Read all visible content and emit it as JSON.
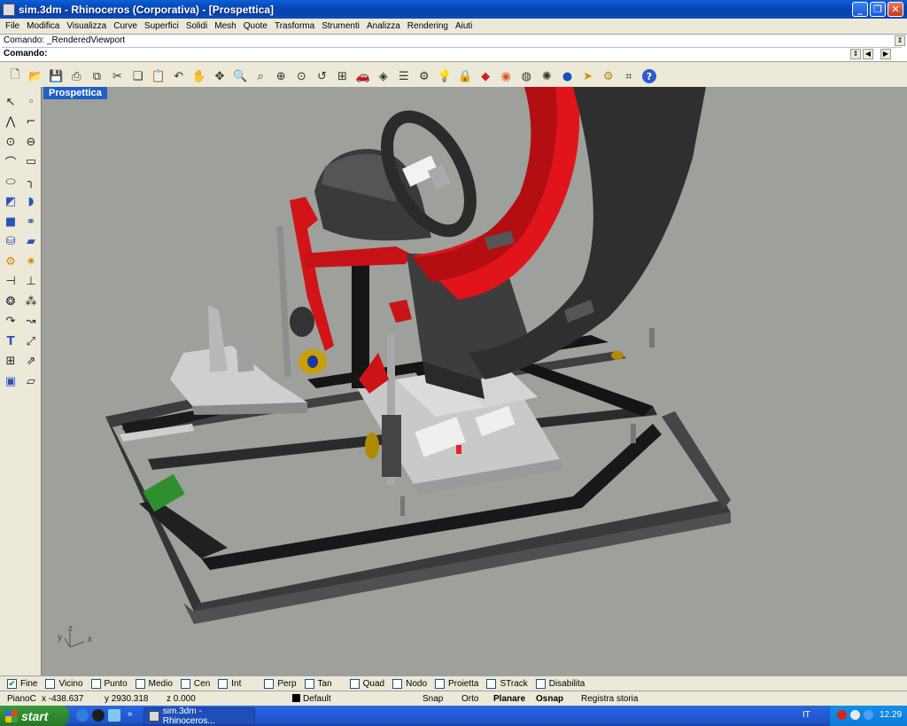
{
  "window": {
    "title": "sim.3dm - Rhinoceros (Corporativa) - [Prospettica]",
    "minimize_icon": "minimize-icon",
    "maximize_icon": "restore-icon",
    "close_icon": "close-icon"
  },
  "menu": [
    "File",
    "Modifica",
    "Visualizza",
    "Curve",
    "Superfici",
    "Solidi",
    "Mesh",
    "Quote",
    "Trasforma",
    "Strumenti",
    "Analizza",
    "Rendering",
    "Aiuti"
  ],
  "command": {
    "history": "Comando: _RenderedViewport",
    "prompt": "Comando:",
    "input_value": ""
  },
  "toolbar_icons": [
    "new-file-icon",
    "open-folder-icon",
    "save-icon",
    "print-icon",
    "export-icon",
    "cut-icon",
    "copy-icon",
    "paste-icon",
    "undo-icon",
    "pan-hand-icon",
    "rotate-view-icon",
    "zoom-icon",
    "zoom-window-icon",
    "zoom-extents-icon",
    "zoom-selected-icon",
    "undo-view-icon",
    "four-viewports-icon",
    "car-icon",
    "render-preview-icon",
    "layers-icon",
    "object-properties-icon",
    "light-icon",
    "lock-icon",
    "shade-icon",
    "color-wheel-icon",
    "sphere-wireframe-icon",
    "render-settings-icon",
    "render-sphere-icon",
    "pointer-cursor-icon",
    "settings-gears-icon",
    "options-icon",
    "help-icon"
  ],
  "left_toolbar_icons": {
    "col1": [
      "select-arrow-icon",
      "polyline-icon",
      "circle-icon",
      "arc-icon",
      "ellipse-icon",
      "surface-edit-icon",
      "box-solid-icon",
      "cylinder-icon",
      "gears-icon",
      "transform-icon",
      "boolean-icon",
      "curve-from-object-icon",
      "text-icon",
      "grid-array-icon",
      "mesh-cube-icon"
    ],
    "col2": [
      "point-icon",
      "curve-edit-icon",
      "rectangle-center-icon",
      "rectangle-icon",
      "fillet-curve-icon",
      "extrude-icon",
      "boolean-union-icon",
      "plane-surface-icon",
      "explode-icon",
      "split-icon",
      "group-icon",
      "offset-icon",
      "align-icon",
      "dimension-icon",
      "mesh-tool-icon"
    ]
  },
  "viewport": {
    "label": "Prospettica",
    "axis_x": "x",
    "axis_y": "y",
    "axis_z": "z",
    "background": "#9ea09b"
  },
  "osnap": [
    {
      "label": "Fine",
      "checked": true
    },
    {
      "label": "Vicino",
      "checked": false
    },
    {
      "label": "Punto",
      "checked": false
    },
    {
      "label": "Medio",
      "checked": false
    },
    {
      "label": "Cen",
      "checked": false
    },
    {
      "label": "Int",
      "checked": false
    },
    {
      "label": "Perp",
      "checked": false
    },
    {
      "label": "Tan",
      "checked": false
    },
    {
      "label": "Quad",
      "checked": false
    },
    {
      "label": "Nodo",
      "checked": false
    },
    {
      "label": "Proietta",
      "checked": false
    },
    {
      "label": "STrack",
      "checked": false
    },
    {
      "label": "Disabilita",
      "checked": false
    }
  ],
  "status": {
    "cplane": "PianoC",
    "x": "x -438.637",
    "y": "y 2930.318",
    "z": "z 0.000",
    "layer": "Default",
    "snap": "Snap",
    "ortho": "Orto",
    "planar": "Planare",
    "osnap": "Osnap",
    "history": "Registra storia"
  },
  "taskbar": {
    "start": "start",
    "task_item": "sim.3dm - Rhinoceros...",
    "language": "IT",
    "clock": "12.29"
  },
  "colors": {
    "titlebar": "#0847b8",
    "viewport_label_bg": "#2160c4",
    "seat_red": "#e0141a",
    "frame_dark": "#3e3e3e",
    "taskbar": "#245edc",
    "start_green": "#2f8a2f"
  }
}
